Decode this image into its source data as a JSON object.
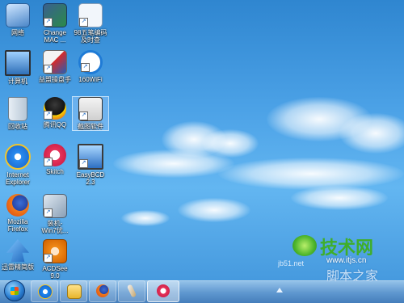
{
  "desktop_icons": [
    {
      "label_lines": [
        "网络"
      ],
      "icon": "network-icon"
    },
    {
      "label_lines": [
        "Change",
        "MAC ..."
      ],
      "icon": "change-mac-icon"
    },
    {
      "label_lines": [
        "98五笔编码",
        "及时查"
      ],
      "icon": "wubi-lookup-icon"
    },
    {
      "label_lines": [
        "计算机"
      ],
      "icon": "computer-icon"
    },
    {
      "label_lines": [
        "益盟操盘手"
      ],
      "icon": "trading-app-icon"
    },
    {
      "label_lines": [
        "160WiFi"
      ],
      "icon": "wifi-icon"
    },
    {
      "label_lines": [
        "回收站"
      ],
      "icon": "recycle-bin-icon"
    },
    {
      "label_lines": [
        "腾讯QQ"
      ],
      "icon": "qq-icon"
    },
    {
      "label_lines": [
        "截图软件"
      ],
      "icon": "camera-icon"
    },
    {
      "label_lines": [
        "Internet",
        "Explorer"
      ],
      "icon": "ie-icon"
    },
    {
      "label_lines": [
        "Skitch"
      ],
      "icon": "skitch-icon"
    },
    {
      "label_lines": [
        "EasyBCD",
        "2.3"
      ],
      "icon": "easybcd-icon"
    },
    {
      "label_lines": [
        "Mozilla",
        "Firefox"
      ],
      "icon": "firefox-icon"
    },
    {
      "label_lines": [
        "装机-",
        "Win7优..."
      ],
      "icon": "win7-optimizer-icon"
    },
    {
      "label_lines": [
        "迅雷精简版"
      ],
      "icon": "xunlei-icon"
    },
    {
      "label_lines": [
        "ACDSee",
        "9.0"
      ],
      "icon": "acdsee-icon"
    }
  ],
  "taskbar": {
    "buttons": [
      "ie-icon",
      "folder-icon",
      "firefox-icon",
      "brush-icon",
      "skitch-icon"
    ]
  },
  "watermark": {
    "brand": "技术网",
    "site": "www.itjs.cn",
    "site2": "jb51.net",
    "home": "脚本之家"
  },
  "colors": {
    "sky": "#4ba1e6",
    "taskbar": "#6096cd",
    "watermark_green": "#3fae2a"
  }
}
